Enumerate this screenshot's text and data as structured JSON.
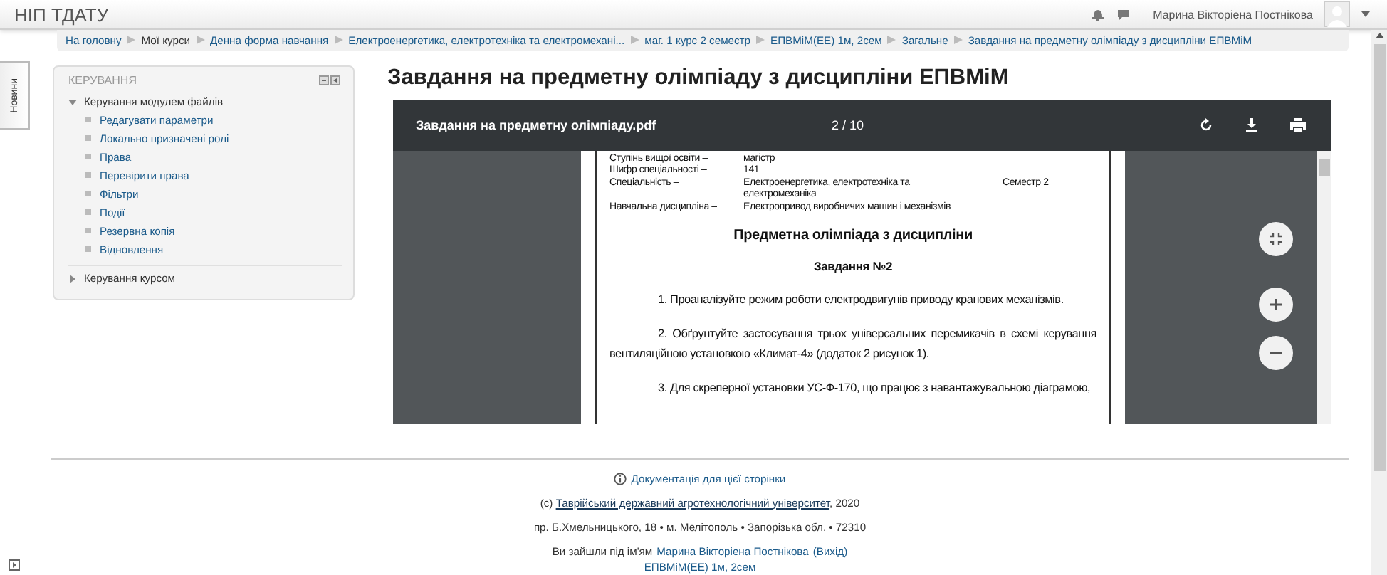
{
  "header": {
    "site_name": "НІП ТДАТУ",
    "user_name": "Марина Вікторіена Постнікова"
  },
  "breadcrumb": [
    {
      "label": "На головну",
      "link": true
    },
    {
      "label": "Мої курси",
      "link": false
    },
    {
      "label": "Денна форма навчання",
      "link": true
    },
    {
      "label": "Електроенергетика, електротехніка та електромехані...",
      "link": true
    },
    {
      "label": "маг. 1 курс 2 семестр",
      "link": true
    },
    {
      "label": "ЕПВМіМ(ЕЕ) 1м, 2сем",
      "link": true
    },
    {
      "label": "Загальне",
      "link": true
    },
    {
      "label": "Завдання на предметну олімпіаду з дисципліни ЕПВМіМ",
      "link": true
    }
  ],
  "side_tab": {
    "label": "Новини"
  },
  "block": {
    "title": "КЕРУВАННЯ",
    "tree": [
      {
        "label": "Керування модулем файлів",
        "expanded": true,
        "children": [
          {
            "label": "Редагувати параметри"
          },
          {
            "label": "Локально призначені ролі"
          },
          {
            "label": "Права"
          },
          {
            "label": "Перевірити права"
          },
          {
            "label": "Фільтри"
          },
          {
            "label": "Події"
          },
          {
            "label": "Резервна копія"
          },
          {
            "label": "Відновлення"
          }
        ]
      },
      {
        "label": "Керування курсом",
        "expanded": false
      }
    ]
  },
  "page_title": "Завдання на предметну олімпіаду з дисципліни ЕПВМіМ",
  "pdf": {
    "file_name": "Завдання на предметну олімпіаду.pdf",
    "page_counter": "2 / 10",
    "fields": [
      {
        "label": "Ступінь вищої освіти –",
        "value": "магістр"
      },
      {
        "label": "Шифр спеціальності –",
        "value": "141"
      },
      {
        "label": "Спеціальність –",
        "value": "Електроенергетика, електротехніка та електромеханіка",
        "extra": "Семестр 2"
      },
      {
        "label": "Навчальна дисципліна –",
        "value": "Електропривод виробничих машин і механізмів"
      }
    ],
    "heading": "Предметна олімпіада з дисципліни",
    "subheading": "Завдання №2",
    "paragraphs": [
      "1. Проаналізуйте режим роботи електродвигунів приводу кранових механізмів.",
      "2. Обґрунтуйте застосування трьох універсальних перемикачів в схемі керування вентиляційною установкою «Климат-4» (додаток 2 рисунок 1).",
      "3. Для скреперної установки УС-Ф-170, що працює з навантажувальною діаграмою,"
    ]
  },
  "footer": {
    "doc_link": "Документація для цієї сторінки",
    "copyright_prefix": "(c)",
    "copyright_link": "Таврійський державний агротехнологічний університет",
    "copyright_suffix": ", 2020",
    "address": "пр. Б.Хмельницького, 18 • м. Мелітополь • Запорізька обл. • 72310",
    "login_prefix": "Ви зайшли під ім'ям",
    "login_user": "Марина Вікторіена Постнікова",
    "logout": "(Вихід)",
    "course_link": "ЕПВМіМ(ЕЕ) 1м, 2сем"
  }
}
